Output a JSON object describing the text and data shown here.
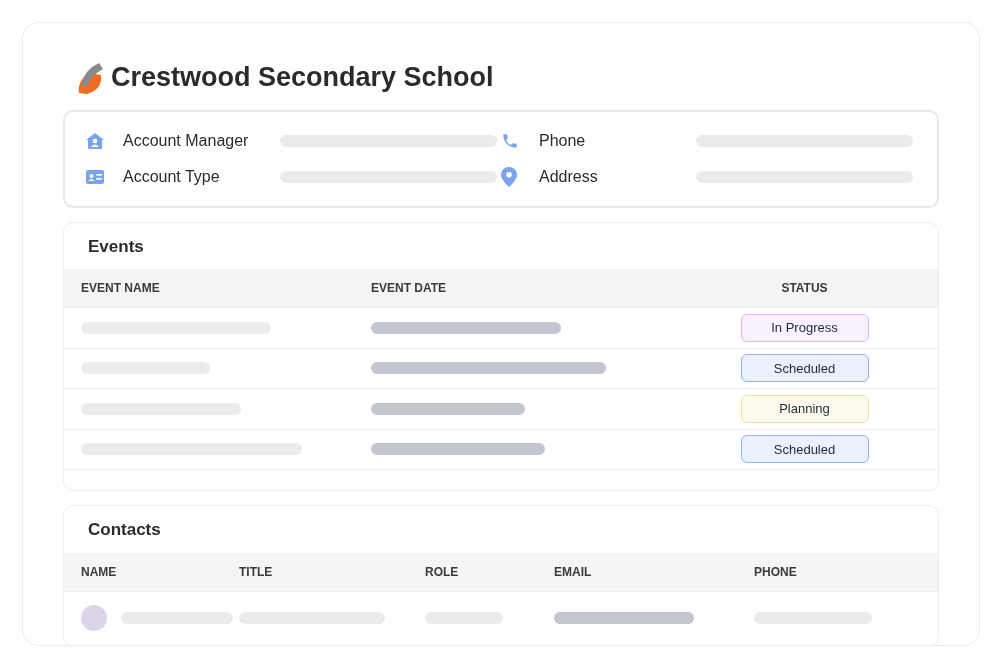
{
  "title": "Crestwood Secondary School",
  "info": [
    {
      "kind": "manager",
      "label": "Account Manager"
    },
    {
      "kind": "phone",
      "label": "Phone"
    },
    {
      "kind": "type",
      "label": "Account Type"
    },
    {
      "kind": "address",
      "label": "Address"
    }
  ],
  "events": {
    "title": "Events",
    "columns": [
      "EVENT NAME",
      "EVENT DATE",
      "STATUS"
    ],
    "rows": [
      {
        "status": "In Progress",
        "color": "#dfb6f2"
      },
      {
        "status": "Scheduled",
        "color": "#8fb4ee"
      },
      {
        "status": "Planning",
        "color": "#f5e2a0"
      },
      {
        "status": "Scheduled",
        "color": "#8fb4ee"
      }
    ]
  },
  "contacts": {
    "title": "Contacts",
    "columns": [
      "NAME",
      "TITLE",
      "ROLE",
      "EMAIL",
      "PHONE"
    ]
  }
}
